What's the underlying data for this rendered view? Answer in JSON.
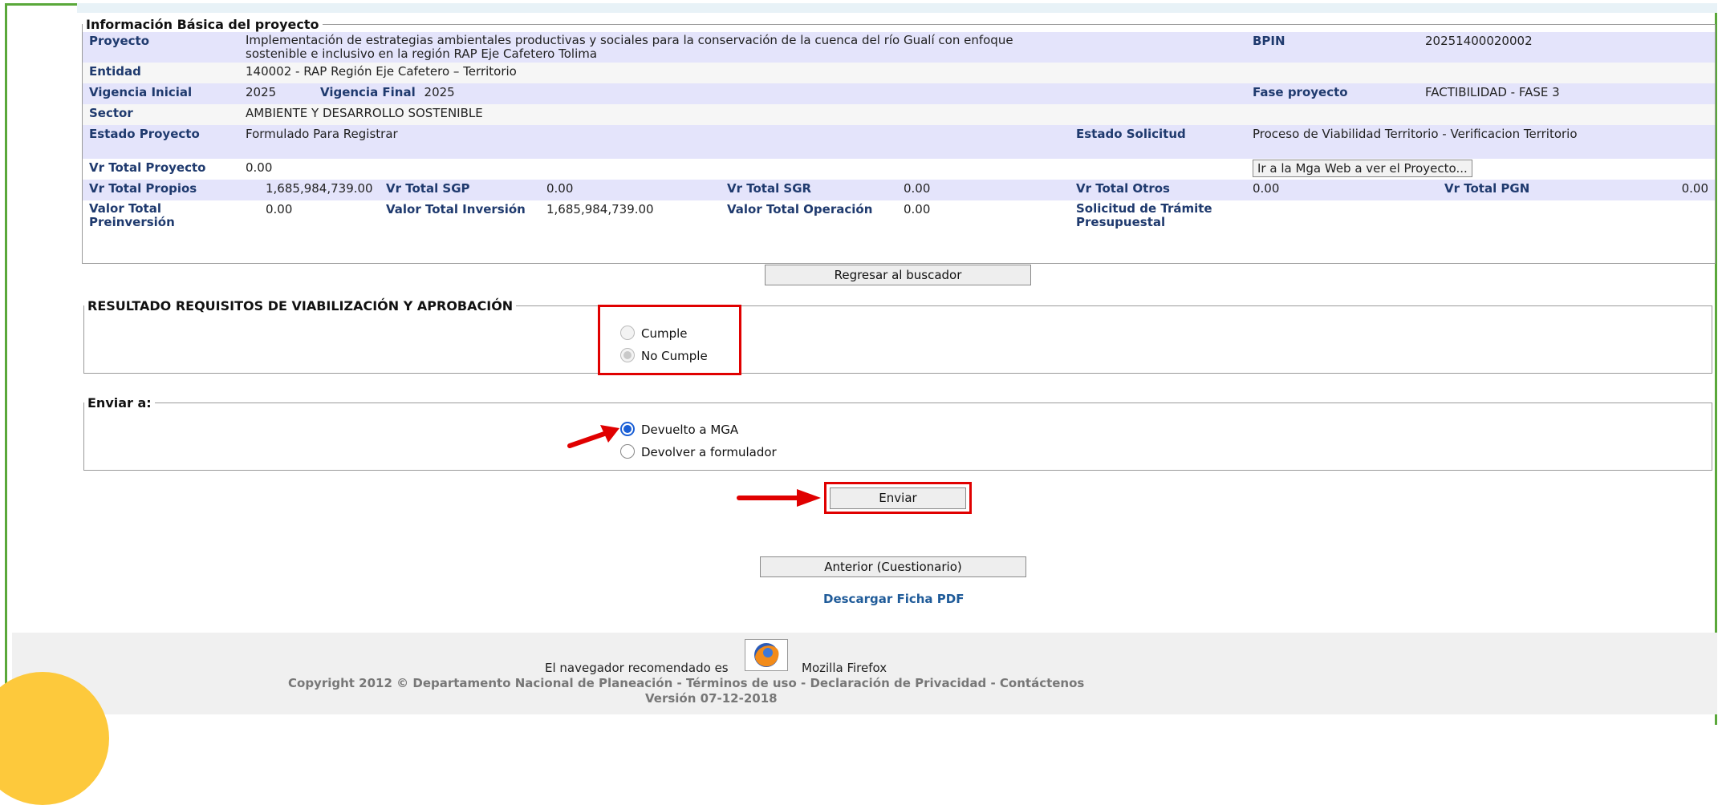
{
  "info_legend": "Información Básica del proyecto",
  "rows": {
    "proyecto_label": "Proyecto",
    "proyecto_value_line1": "Implementación de estrategias ambientales productivas y sociales para la conservación de la cuenca del río Gualí con enfoque",
    "proyecto_value_line2": "sostenible e inclusivo en la región RAP Eje Cafetero Tolima",
    "bpin_label": "BPIN",
    "bpin_value": "20251400020002",
    "entidad_label": "Entidad",
    "entidad_value": "140002 - RAP Región Eje Cafetero – Territorio",
    "vig_ini_label": "Vigencia Inicial",
    "vig_ini_value": "2025",
    "vig_fin_label": "Vigencia Final",
    "vig_fin_value": "2025",
    "fase_label": "Fase proyecto",
    "fase_value": "FACTIBILIDAD - FASE 3",
    "sector_label": "Sector",
    "sector_value": "AMBIENTE Y DESARROLLO SOSTENIBLE",
    "estado_proy_label": "Estado Proyecto",
    "estado_proy_value": "Formulado Para Registrar",
    "estado_sol_label": "Estado Solicitud",
    "estado_sol_value": "Proceso de Viabilidad Territorio - Verificacion Territorio",
    "vr_total_proy_label": "Vr Total Proyecto",
    "vr_total_proy_value": "0.00",
    "mga_button": "Ir a la Mga Web a ver el Proyecto...",
    "vr_propios_label": "Vr Total Propios",
    "vr_propios_value": "1,685,984,739.00",
    "vr_sgp_label": "Vr Total SGP",
    "vr_sgp_value": "0.00",
    "vr_sgr_label": "Vr Total SGR",
    "vr_sgr_value": "0.00",
    "vr_otros_label": "Vr Total Otros",
    "vr_otros_value": "0.00",
    "vr_pgn_label": "Vr Total PGN",
    "vr_pgn_value": "0.00",
    "val_preinv_label1": "Valor Total",
    "val_preinv_label2": "Preinversión",
    "val_preinv_value": "0.00",
    "val_inv_label": "Valor Total Inversión",
    "val_inv_value": "1,685,984,739.00",
    "val_oper_label": "Valor Total Operación",
    "val_oper_value": "0.00",
    "sol_tramite_label1": "Solicitud de Trámite",
    "sol_tramite_label2": "Presupuestal"
  },
  "regresar_button": "Regresar al buscador",
  "resultado": {
    "legend": "RESULTADO REQUISITOS DE VIABILIZACIÓN Y APROBACIÓN",
    "opt1": "Cumple",
    "opt2": "No Cumple",
    "selected": "No Cumple"
  },
  "enviar_a": {
    "legend": "Enviar a:",
    "opt1": "Devuelto a MGA",
    "opt2": "Devolver a formulador",
    "selected": "Devuelto a MGA"
  },
  "enviar_button": "Enviar",
  "anterior_button": "Anterior (Cuestionario)",
  "descargar_link": "Descargar Ficha PDF",
  "footer": {
    "browser_text_before": "El navegador recomendado es",
    "browser_text_after": "Mozilla Firefox",
    "copyright": "Copyright 2012 © Departamento Nacional de Planeación",
    "sep": "-",
    "terminos": "Términos de uso",
    "privacidad": "Declaración de Privacidad",
    "contactenos": "Contáctenos",
    "version": "Versión 07-12-2018"
  },
  "colors": {
    "frame": "#5aa83a",
    "label": "#1f3a6e",
    "row_alt": "#e4e4fb",
    "highlight": "#e00000",
    "link": "#1f5b99"
  }
}
